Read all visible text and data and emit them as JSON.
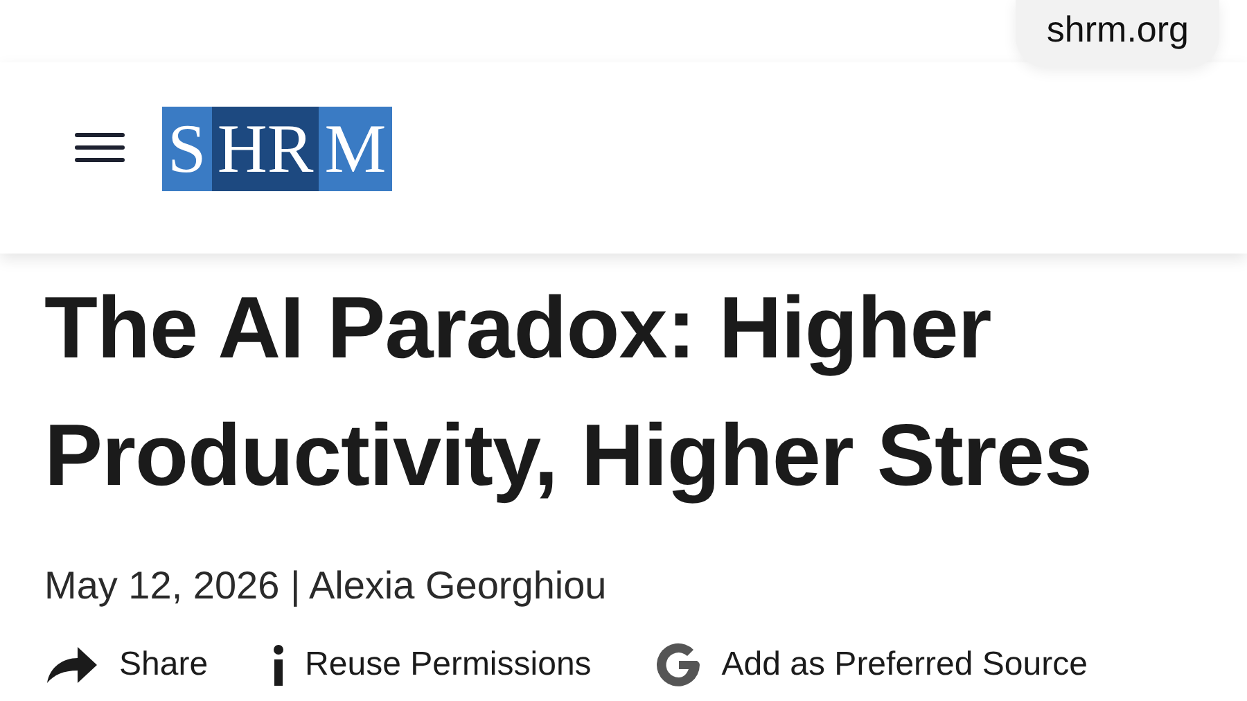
{
  "address_bar": {
    "url": "shrm.org"
  },
  "header": {
    "logo": {
      "segments": [
        {
          "text": "S",
          "dark": false
        },
        {
          "text": "HR",
          "dark": true
        },
        {
          "text": "M",
          "dark": false
        }
      ]
    }
  },
  "article": {
    "title_lines": [
      "The AI Paradox: Higher",
      "Productivity, Higher Stres"
    ],
    "byline": "May 12, 2026 | Alexia Georghiou",
    "actions": [
      {
        "kind": "share",
        "label": "Share"
      },
      {
        "kind": "info",
        "label": "Reuse Permissions"
      },
      {
        "kind": "google",
        "label": "Add as Preferred Source"
      }
    ]
  }
}
